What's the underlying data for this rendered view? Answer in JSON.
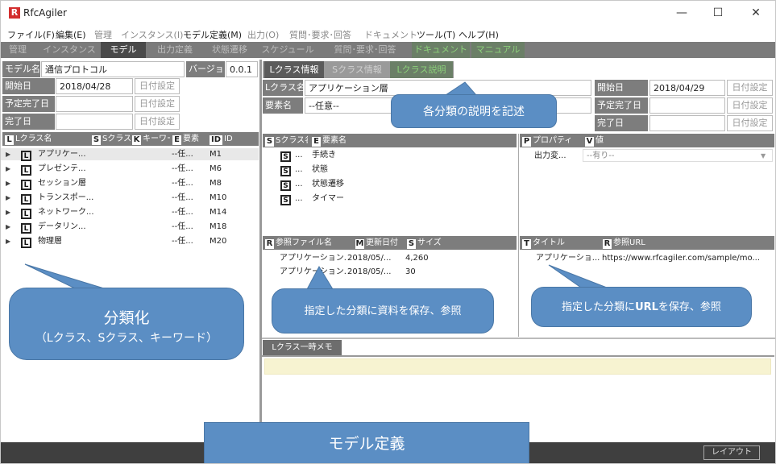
{
  "window": {
    "title": "RfcAgiler",
    "logo_letter": "R",
    "minimize": "—",
    "maximize": "☐",
    "close": "✕"
  },
  "menu": [
    "ファイル(F)",
    "編集(E)",
    "管理",
    "インスタンス(I)",
    "モデル定義(M)",
    "出力(O)",
    "質問･要求･回答",
    "ドキュメント",
    "ツール(T)",
    "ヘルプ(H)"
  ],
  "nav_tabs": [
    "管理",
    "インスタンス",
    "モデル",
    "出力定義",
    "状態遷移",
    "スケジュール",
    "質問･要求･回答",
    "ドキュメント",
    "マニュアル"
  ],
  "model": {
    "name_label": "モデル名",
    "name_value": "通信プロトコル",
    "version_label": "バージョン",
    "version_value": "0.0.1",
    "start_label": "開始日",
    "start_value": "2018/04/28",
    "planned_label": "予定完了日",
    "planned_value": "",
    "done_label": "完了日",
    "done_value": "",
    "date_button": "日付設定"
  },
  "left_tree": {
    "headers": {
      "l": "Lクラス名",
      "s": "Sクラス",
      "k": "キーワード",
      "e": "要素",
      "id": "ID"
    },
    "rows": [
      {
        "name": "アプリケー...",
        "elem": "--任...",
        "id": "M1"
      },
      {
        "name": "プレゼンテ...",
        "elem": "--任...",
        "id": "M6"
      },
      {
        "name": "セッション層",
        "elem": "--任...",
        "id": "M8"
      },
      {
        "name": "トランスポー...",
        "elem": "--任...",
        "id": "M10"
      },
      {
        "name": "ネットワーク...",
        "elem": "--任...",
        "id": "M14"
      },
      {
        "name": "データリン...",
        "elem": "--任...",
        "id": "M18"
      },
      {
        "name": "物理層",
        "elem": "--任...",
        "id": "M20"
      }
    ]
  },
  "right_tabs": [
    "Lクラス情報",
    "Sクラス情報",
    "Lクラス説明"
  ],
  "lclass": {
    "name_label": "Lクラス名",
    "name_value": "アプリケーション層",
    "elem_label": "要素名",
    "elem_value": "--任意--",
    "start_label": "開始日",
    "start_value": "2018/04/29",
    "planned_label": "予定完了日",
    "done_label": "完了日",
    "date_button": "日付設定"
  },
  "sclass_table": {
    "headers": {
      "s": "Sクラス名",
      "e": "要素名"
    },
    "rows": [
      {
        "s": "...",
        "e": "手続き"
      },
      {
        "s": "...",
        "e": "状態"
      },
      {
        "s": "...",
        "e": "状態遷移"
      },
      {
        "s": "...",
        "e": "タイマー"
      }
    ]
  },
  "prop_table": {
    "headers": {
      "p": "プロパティ",
      "v": "値"
    },
    "rows": [
      {
        "p": "出力変...",
        "v": "--有り--"
      }
    ]
  },
  "file_table": {
    "headers": {
      "r": "参照ファイル名",
      "m": "更新日付",
      "s": "サイズ"
    },
    "rows": [
      {
        "r": "アプリケーション...",
        "m": "2018/05/...",
        "s": "4,260"
      },
      {
        "r": "アプリケーション...",
        "m": "2018/05/...",
        "s": "30"
      }
    ]
  },
  "url_table": {
    "headers": {
      "t": "タイトル",
      "r": "参照URL"
    },
    "rows": [
      {
        "t": "アプリケーショ...",
        "r": "https://www.rfcagiler.com/sample/mo..."
      }
    ]
  },
  "memo": {
    "tab": "Lクラス一時メモ"
  },
  "status": {
    "layout_button": "レイアウト"
  },
  "callouts": {
    "describe": "各分類の説明を記述",
    "classify_title": "分類化",
    "classify_sub": "（Lクラス、Sクラス、キーワード）",
    "file": "指定した分類に資料を保存、参照",
    "url_pre": "指定した分類に",
    "url_bold": "URL",
    "url_post": "を保存、参照",
    "model": "モデル定義"
  }
}
